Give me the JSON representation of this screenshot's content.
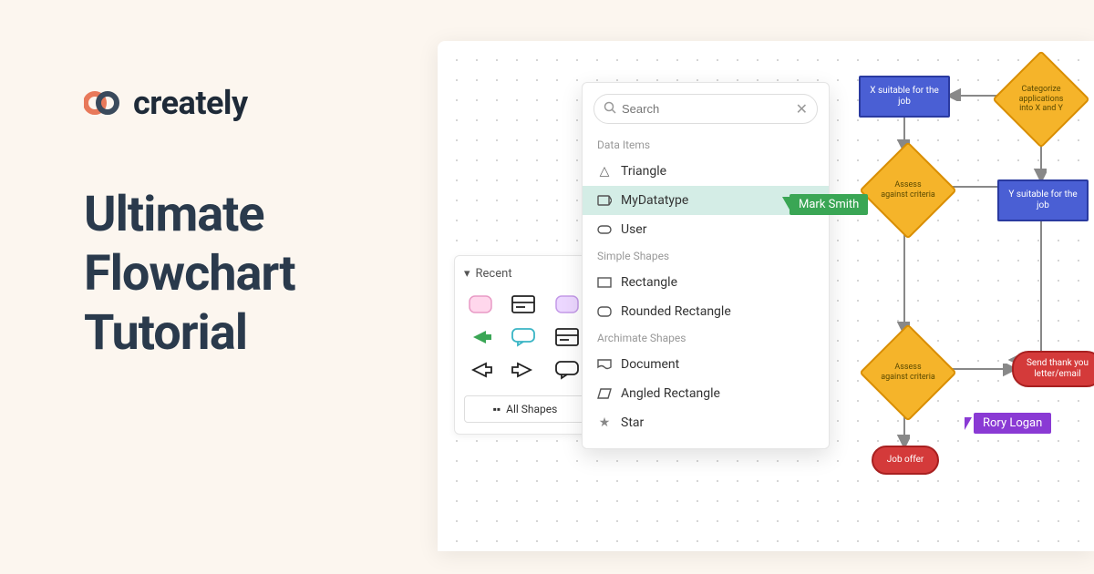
{
  "brand": {
    "name": "creately"
  },
  "headline": {
    "l1": "Ultimate",
    "l2": "Flowchart",
    "l3": "Tutorial"
  },
  "sidebar": {
    "recent_label": "Recent",
    "all_shapes": "All Shapes"
  },
  "popover": {
    "search_placeholder": "Search",
    "sections": {
      "data_items": {
        "label": "Data Items",
        "items": [
          "Triangle",
          "MyDatatype",
          "User"
        ]
      },
      "simple_shapes": {
        "label": "Simple Shapes",
        "items": [
          "Rectangle",
          "Rounded Rectangle"
        ]
      },
      "archimate": {
        "label": "Archimate Shapes",
        "items": [
          "Document",
          "Angled Rectangle",
          "Star"
        ]
      }
    }
  },
  "flow": {
    "x_suitable": "X suitable for the job",
    "categorize": "Categorize applications into X and Y",
    "assess1": "Assess against criteria",
    "y_suitable": "Y suitable for the job",
    "assess2": "Assess against criteria",
    "send_thank": "Send thank you letter/email",
    "job_offer": "Job offer"
  },
  "cursors": {
    "mark": "Mark Smith",
    "rory": "Rory Logan"
  }
}
